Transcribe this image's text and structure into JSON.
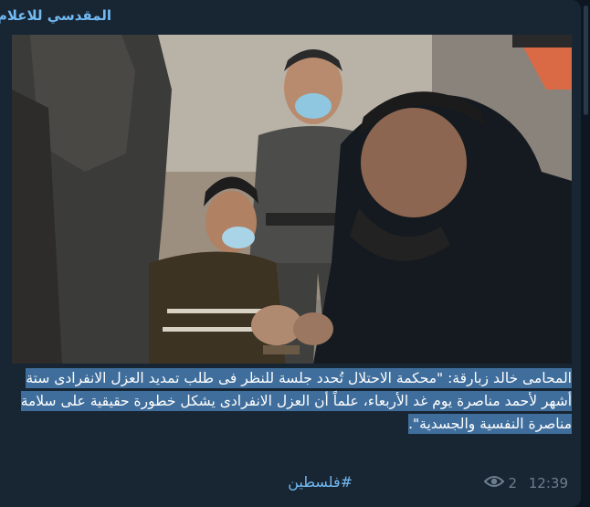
{
  "channel": {
    "name": "المقدسي للاعلام"
  },
  "post": {
    "caption": "المحامى خالد زبارقة: \"محكمة الاحتلال تُحدد جلسة للنظر فى طلب تمديد العزل الانفرادى ستة أشهر لأحمد مناصرة يوم غد الأربعاء، علماً أن العزل الانفرادى يشكل خطورة حقيقية على سلامة مناصرة النفسية والجسدية\".",
    "hashtag": "#فلسطين",
    "views": "2",
    "time": "12:39"
  },
  "icons": {
    "views": "eye-icon"
  },
  "colors": {
    "accent": "#71baf3",
    "highlight": "#3f6e9c",
    "bubble": "#182533"
  }
}
